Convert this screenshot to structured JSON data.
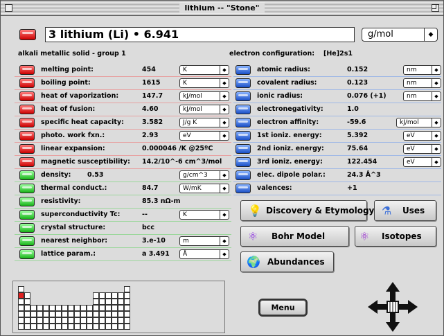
{
  "window": {
    "title": "lithium -- \"Stone\""
  },
  "element": {
    "heading": "3 lithium (Li) • 6.941",
    "unit": "g/mol",
    "category": "alkali metallic solid - group 1",
    "config_label": "electron configuration:",
    "config_value": "[He]2s1"
  },
  "left_properties": [
    {
      "label": "melting point:",
      "value": "454",
      "unit": "K",
      "color": "red"
    },
    {
      "label": "boiling point:",
      "value": "1615",
      "unit": "K",
      "color": "red"
    },
    {
      "label": "heat of vaporization:",
      "value": "147.7",
      "unit": "kJ/mol",
      "color": "red"
    },
    {
      "label": "heat of fusion:",
      "value": "4.60",
      "unit": "kJ/mol",
      "color": "red"
    },
    {
      "label": "specific heat capacity:",
      "value": "3.582",
      "unit": "J/g K",
      "color": "red"
    },
    {
      "label": "photo. work fxn.:",
      "value": "2.93",
      "unit": "eV",
      "color": "red"
    },
    {
      "label": "linear expansion:",
      "value": "0.000046 /K @25ºC",
      "unit": "",
      "color": "red"
    },
    {
      "label": "magnetic susceptibility:",
      "value": "14.2/10^-6 cm^3/mol",
      "unit": "",
      "color": "red"
    },
    {
      "label": "density:",
      "value": "0.53",
      "unit": "g/cm^3",
      "color": "green",
      "inline": true
    },
    {
      "label": "thermal conduct.:",
      "value": "84.7",
      "unit": "W/mK",
      "color": "green"
    },
    {
      "label": "resistivity:",
      "value": "85.3 nΩ-m",
      "unit": "",
      "color": "green"
    },
    {
      "label": "superconductivity Tc:",
      "value": "--",
      "unit": "K",
      "color": "green"
    },
    {
      "label": "crystal structure:",
      "value": "bcc",
      "unit": "",
      "color": "green"
    },
    {
      "label": "nearest neighbor:",
      "value": "3.e-10",
      "unit": "m",
      "color": "green"
    },
    {
      "label": "lattice param.:",
      "value": "a 3.491",
      "unit": "Å",
      "color": "green"
    }
  ],
  "right_properties": [
    {
      "label": "atomic radius:",
      "value": "0.152",
      "unit": "nm"
    },
    {
      "label": "covalent radius:",
      "value": "0.123",
      "unit": "nm"
    },
    {
      "label": "ionic radius:",
      "value": "0.076 (+1)",
      "unit": "nm"
    },
    {
      "label": "electronegativity:",
      "value": "1.0",
      "unit": ""
    },
    {
      "label": "electron affinity:",
      "value": "-59.6",
      "unit": "kJ/mol"
    },
    {
      "label": "1st ioniz. energy:",
      "value": "5.392",
      "unit": "eV"
    },
    {
      "label": "2nd ioniz. energy:",
      "value": "75.64",
      "unit": "eV"
    },
    {
      "label": "3rd ioniz. energy:",
      "value": "122.454",
      "unit": "eV"
    },
    {
      "label": "elec. dipole polar.:",
      "value": "24.3 Å^3",
      "unit": ""
    },
    {
      "label": "valences:",
      "value": "+1",
      "unit": ""
    }
  ],
  "buttons": {
    "discovery": "Discovery & Etymology",
    "uses": "Uses",
    "bohr": "Bohr Model",
    "isotopes": "Isotopes",
    "abundances": "Abundances",
    "menu": "Menu"
  },
  "colors": {
    "red_icon": "#cc0000",
    "blue_icon": "#1a4fc7",
    "green_icon": "#17b317",
    "highlight_cell": "#e02020"
  }
}
